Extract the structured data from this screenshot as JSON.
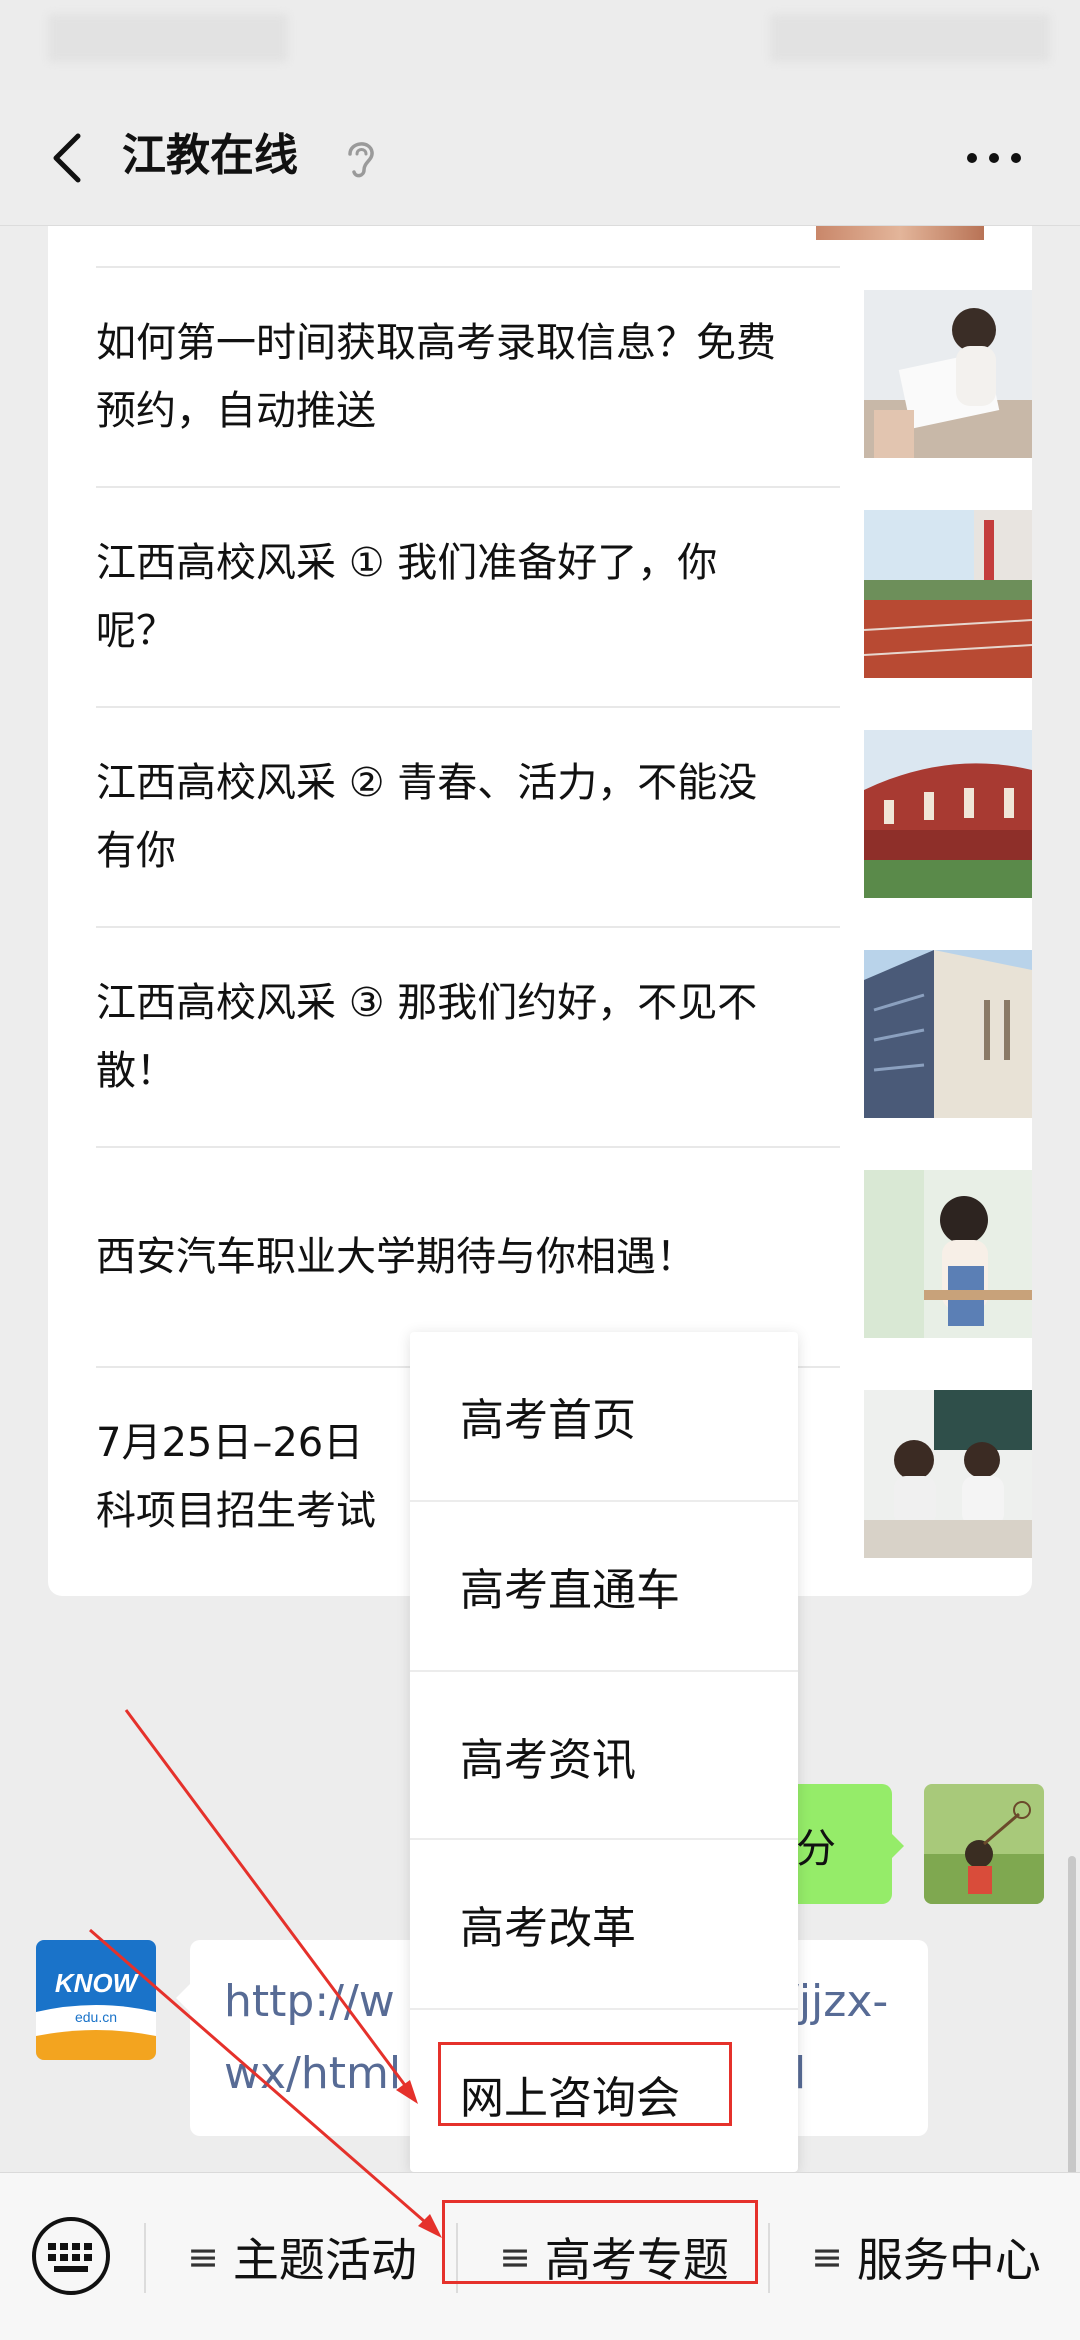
{
  "header": {
    "title": "江教在线"
  },
  "articles": [
    {
      "title": "如何第一时间获取高考录取信息？免费预约，自动推送"
    },
    {
      "title": "江西高校风采 ① 我们准备好了，你呢？"
    },
    {
      "title": "江西高校风采 ② 青春、活力，不能没有你"
    },
    {
      "title": "江西高校风采 ③ 那我们约好，不见不散！"
    },
    {
      "title": "西安汽车职业大学期待与你相遇！"
    },
    {
      "title": "7月25日–26日"
    },
    {
      "title_line2": "科项目招生考试"
    }
  ],
  "chat": {
    "sent_text_fragment": "分",
    "link_line1": "http://w",
    "link_line1_end": "/jjzx-",
    "link_line2": "wx/html",
    "link_line2_end": "l",
    "sender_logo_text": "KNOW",
    "sender_logo_sub": "edu.cn"
  },
  "popup_menu": {
    "items": [
      "高考首页",
      "高考直通车",
      "高考资讯",
      "高考改革",
      "网上咨询会"
    ],
    "highlighted_index": 4
  },
  "bottom_menu": {
    "items": [
      {
        "label": "主题活动"
      },
      {
        "label": "高考专题"
      },
      {
        "label": "服务中心"
      }
    ],
    "lines_glyph": "≡",
    "highlighted_index": 1
  },
  "colors": {
    "accent_red": "#e5312b",
    "bubble_green": "#95ec69",
    "link_blue": "#576b95"
  }
}
